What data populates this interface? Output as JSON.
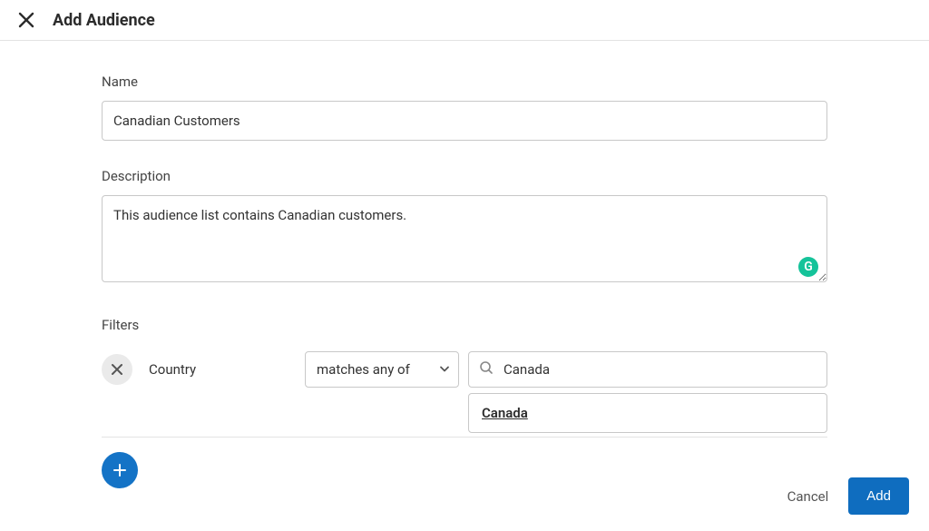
{
  "header": {
    "title": "Add Audience"
  },
  "form": {
    "name_label": "Name",
    "name_value": "Canadian Customers",
    "description_label": "Description",
    "description_value": "This audience list contains Canadian customers.",
    "grammarly_badge": "G"
  },
  "filters": {
    "label": "Filters",
    "rows": [
      {
        "attribute": "Country",
        "operator": "matches any of",
        "value": "Canada"
      }
    ],
    "dropdown": {
      "options": [
        "Canada"
      ]
    }
  },
  "footer": {
    "cancel_label": "Cancel",
    "add_label": "Add"
  }
}
